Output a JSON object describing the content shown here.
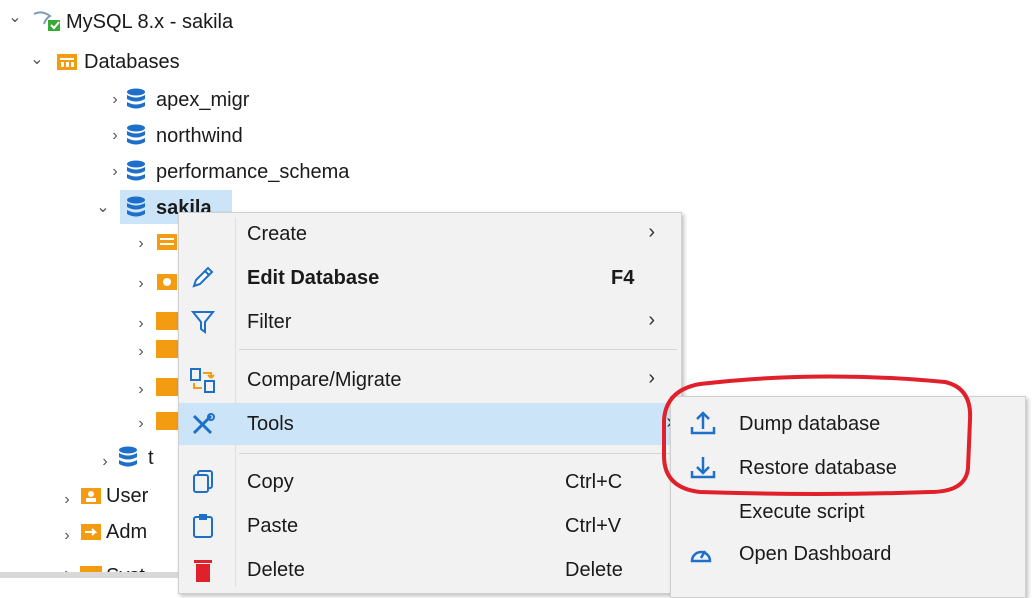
{
  "tree": {
    "connection": "MySQL 8.x - sakila",
    "databases_folder": "Databases",
    "databases": [
      "apex_migr",
      "northwind",
      "performance_schema",
      "sakila"
    ],
    "partial_db": "t",
    "partial_users": "User",
    "partial_admin": "Adm",
    "partial_system": "Syst"
  },
  "context_menu": {
    "create": "Create",
    "edit_database": "Edit Database",
    "edit_shortcut": "F4",
    "filter": "Filter",
    "compare": "Compare/Migrate",
    "tools": "Tools",
    "copy": "Copy",
    "copy_shortcut": "Ctrl+C",
    "paste": "Paste",
    "paste_shortcut": "Ctrl+V",
    "delete": "Delete",
    "delete_shortcut": "Delete"
  },
  "tools_submenu": {
    "dump": "Dump database",
    "restore": "Restore database",
    "execute": "Execute script",
    "dashboard": "Open Dashboard"
  },
  "colors": {
    "highlight": "#cce4f7",
    "annotation": "#e0202a",
    "folder_orange": "#f39c12",
    "db_blue": "#1e6fc8"
  }
}
